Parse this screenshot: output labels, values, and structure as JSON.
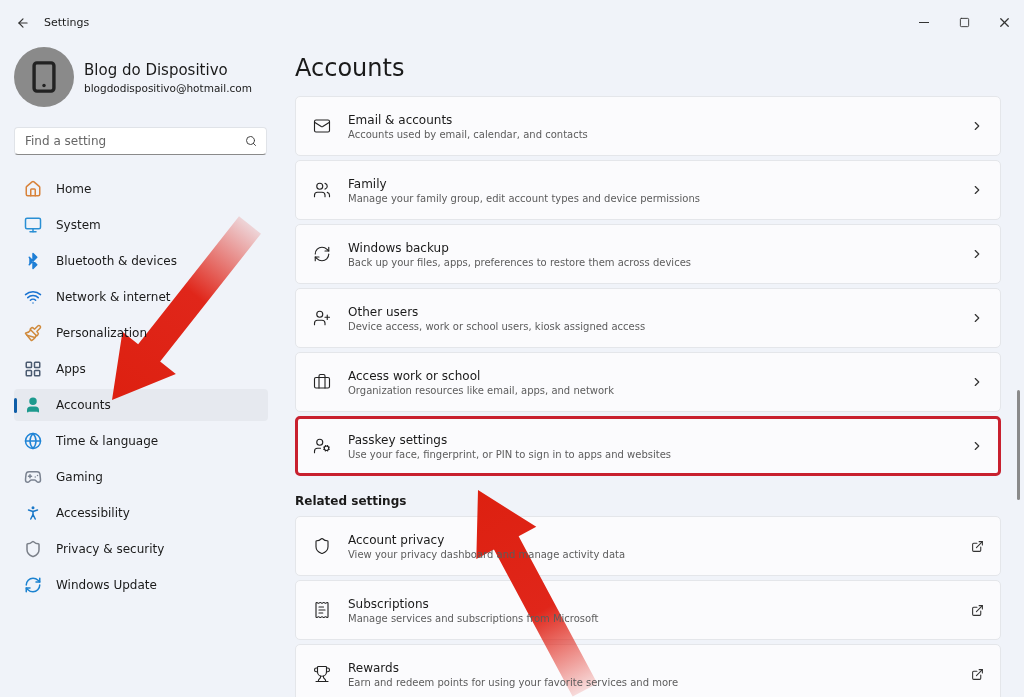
{
  "window": {
    "title": "Settings"
  },
  "profile": {
    "name": "Blog do Dispositivo",
    "email": "blogdodispositivo@hotmail.com"
  },
  "search": {
    "placeholder": "Find a setting"
  },
  "sidebar": {
    "items": [
      {
        "label": "Home",
        "selected": false
      },
      {
        "label": "System",
        "selected": false
      },
      {
        "label": "Bluetooth & devices",
        "selected": false
      },
      {
        "label": "Network & internet",
        "selected": false
      },
      {
        "label": "Personalization",
        "selected": false
      },
      {
        "label": "Apps",
        "selected": false
      },
      {
        "label": "Accounts",
        "selected": true
      },
      {
        "label": "Time & language",
        "selected": false
      },
      {
        "label": "Gaming",
        "selected": false
      },
      {
        "label": "Accessibility",
        "selected": false
      },
      {
        "label": "Privacy & security",
        "selected": false
      },
      {
        "label": "Windows Update",
        "selected": false
      }
    ]
  },
  "page": {
    "title": "Accounts"
  },
  "cards": [
    {
      "title": "Email & accounts",
      "description": "Accounts used by email, calendar, and contacts",
      "highlighted": false
    },
    {
      "title": "Family",
      "description": "Manage your family group, edit account types and device permissions",
      "highlighted": false
    },
    {
      "title": "Windows backup",
      "description": "Back up your files, apps, preferences to restore them across devices",
      "highlighted": false
    },
    {
      "title": "Other users",
      "description": "Device access, work or school users, kiosk assigned access",
      "highlighted": false
    },
    {
      "title": "Access work or school",
      "description": "Organization resources like email, apps, and network",
      "highlighted": false
    },
    {
      "title": "Passkey settings",
      "description": "Use your face, fingerprint, or PIN to sign in to apps and websites",
      "highlighted": true
    }
  ],
  "related": {
    "heading": "Related settings",
    "cards": [
      {
        "title": "Account privacy",
        "description": "View your privacy dashboard and manage activity data"
      },
      {
        "title": "Subscriptions",
        "description": "Manage services and subscriptions from Microsoft"
      },
      {
        "title": "Rewards",
        "description": "Earn and redeem points for using your favorite services and more"
      }
    ]
  }
}
